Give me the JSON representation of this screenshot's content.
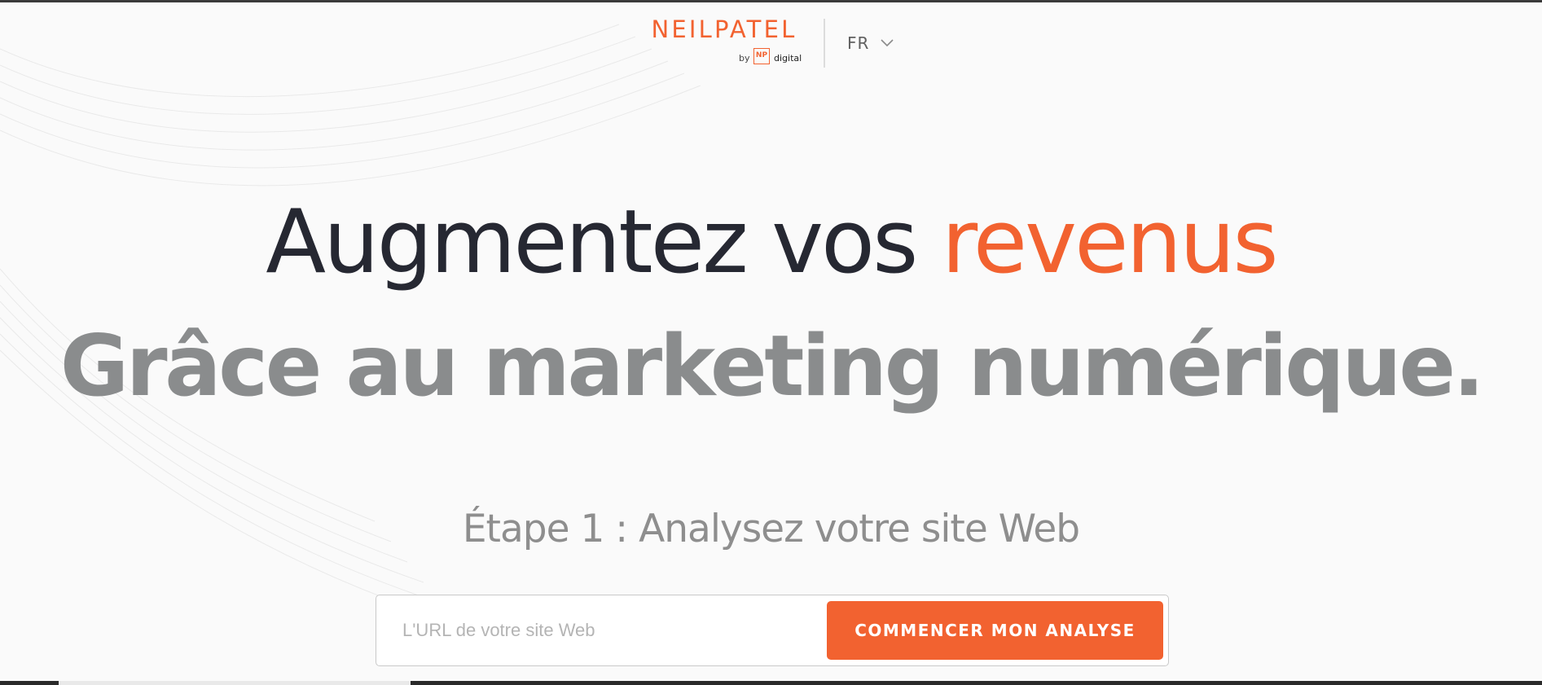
{
  "header": {
    "brand": "NEILPATEL",
    "brand_by": "by",
    "brand_np": "NP",
    "brand_digital": "digital",
    "language": "FR"
  },
  "hero": {
    "headline_main": "Augmentez vos ",
    "headline_accent": "revenus",
    "headline_sub": "Grâce au marketing numérique.",
    "step_label": "Étape 1 : Analysez votre site Web"
  },
  "form": {
    "url_placeholder": "L'URL de votre site Web",
    "url_value": "",
    "submit_label": "COMMENCER MON ANALYSE"
  },
  "icons": {
    "language_dropdown": "chevron-down-icon",
    "brand_mark": "np-logo-icon"
  },
  "colors": {
    "accent": "#f26230",
    "headline_dark": "#262832",
    "headline_gray": "#8a8c8d",
    "step_text": "#8e8e8e",
    "background": "#fafafa"
  }
}
